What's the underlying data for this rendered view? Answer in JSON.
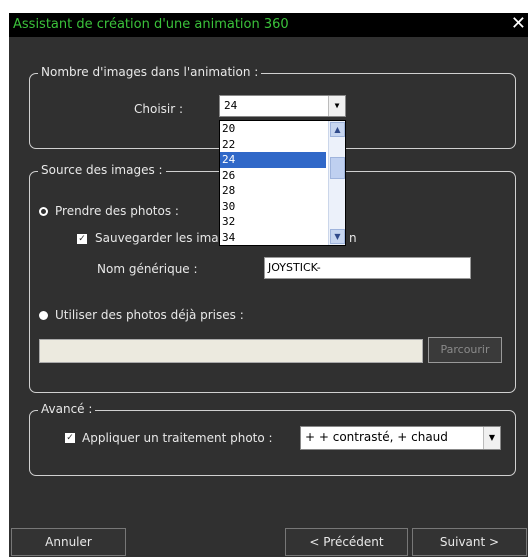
{
  "window": {
    "title": "Assistant de création d'une animation 360",
    "close_glyph": "✕"
  },
  "images_count": {
    "legend": "Nombre d'images dans l'animation :",
    "label": "Choisir :",
    "selected": "24",
    "options": [
      "20",
      "22",
      "24",
      "26",
      "28",
      "30",
      "32",
      "34"
    ]
  },
  "source": {
    "legend": "Source des images :",
    "take_photos_label": "Prendre des photos :",
    "save_images_label": "Sauvegarder les ima",
    "save_images_tail": "n",
    "generic_name_label": "Nom générique :",
    "generic_name_value": "JOYSTICK-",
    "use_existing_label": "Utiliser des photos déjà prises :",
    "path_value": "",
    "browse_label": "Parcourir"
  },
  "advanced": {
    "legend": "Avancé :",
    "apply_label": "Appliquer un traitement photo :",
    "apply_value": "+ + contrasté, + chaud"
  },
  "footer": {
    "cancel_label": "Annuler",
    "previous_label": "< Précédent",
    "next_label": "Suivant >"
  },
  "colors": {
    "title_text": "#3bc23b",
    "window_bg": "#303030",
    "selection": "#3068c8"
  }
}
